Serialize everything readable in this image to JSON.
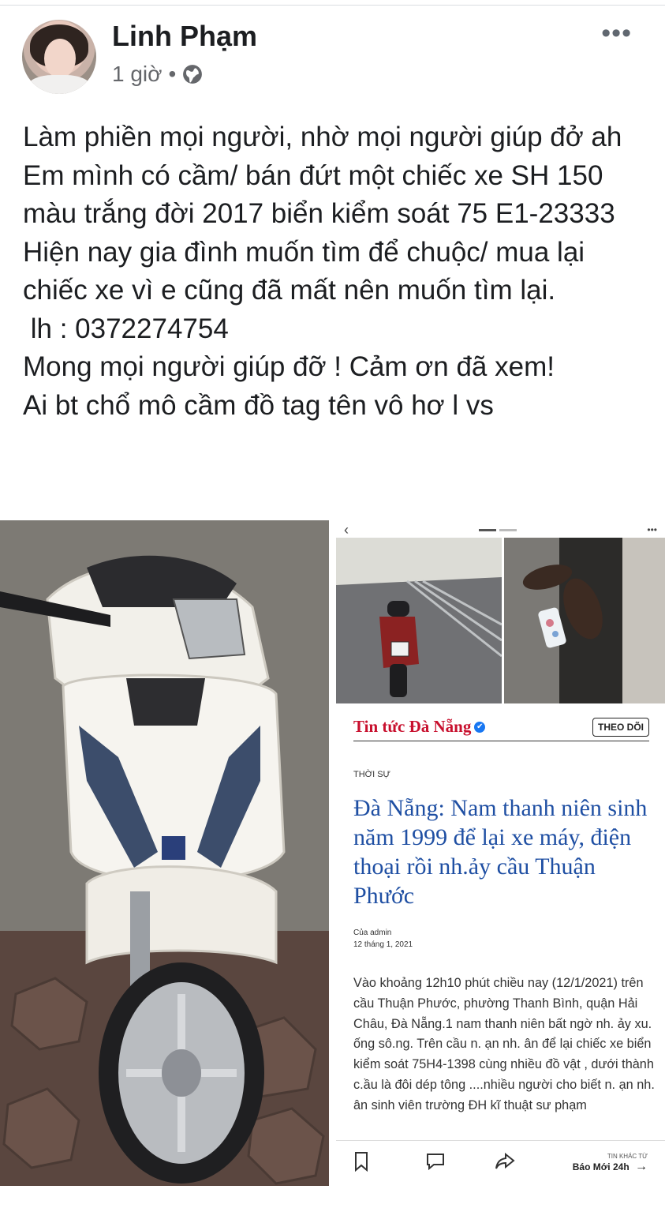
{
  "post": {
    "author": "Linh Phạm",
    "time": "1 giờ",
    "separator": "•",
    "privacy_icon": "globe-icon",
    "more_icon": "more-horizontal-icon",
    "more_glyph": "•••",
    "text": "Làm phiền mọi người, nhờ mọi người giúp đở ah\nEm mình có cầm/ bán đứt một chiếc xe SH 150 màu trắng đời 2017 biển kiểm soát 75 E1-23333\nHiện nay gia đình muốn tìm để chuộc/ mua lại chiếc xe vì e cũng đã mất nên muốn tìm lại.\n lh : 0372274754\nMong mọi người giúp đỡ ! Cảm ơn đã xem!\nAi bt chổ mô cầm đồ tag tên vô hơ l vs"
  },
  "screenshot": {
    "back_glyph": "‹",
    "menu_glyph": "•••",
    "source_name": "Tin tức Đà Nẵng",
    "verified_glyph": "✔",
    "follow_label": "THEO DÕI",
    "category": "THỜI SỰ",
    "headline": "Đà Nẵng: Nam thanh niên sinh năm 1999 để lại xe máy, điện thoại rồi nh.ảy cầu Thuận Phước",
    "author_line": "Của admin",
    "date_line": "12 tháng 1, 2021",
    "article": "Vào khoảng 12h10 phút chiều nay (12/1/2021) trên cầu Thuận Phước, phường Thanh Bình, quận Hải Châu, Đà Nẵng.1 nam thanh niên bất ngờ nh. ảy xu. ống sô.ng. Trên cầu n. ạn nh. ân để lại chiếc xe biển kiểm soát 75H4-1398 cùng nhiều đồ vật , dưới thành c.ầu là đôi dép tông ....nhiều người cho biết n. ạn nh. ân sinh viên trường ĐH kĩ thuật sư phạm",
    "bar": {
      "bookmark_glyph": "🔖",
      "comment_glyph": "💬",
      "share_glyph": "➦",
      "other_label": "TIN KHÁC TỪ",
      "other_source": "Báo Mới 24h",
      "arrow_glyph": "→"
    }
  },
  "colors": {
    "headline_blue": "#1f4fa3",
    "source_red": "#c8102e",
    "meta_gray": "#65676b"
  }
}
